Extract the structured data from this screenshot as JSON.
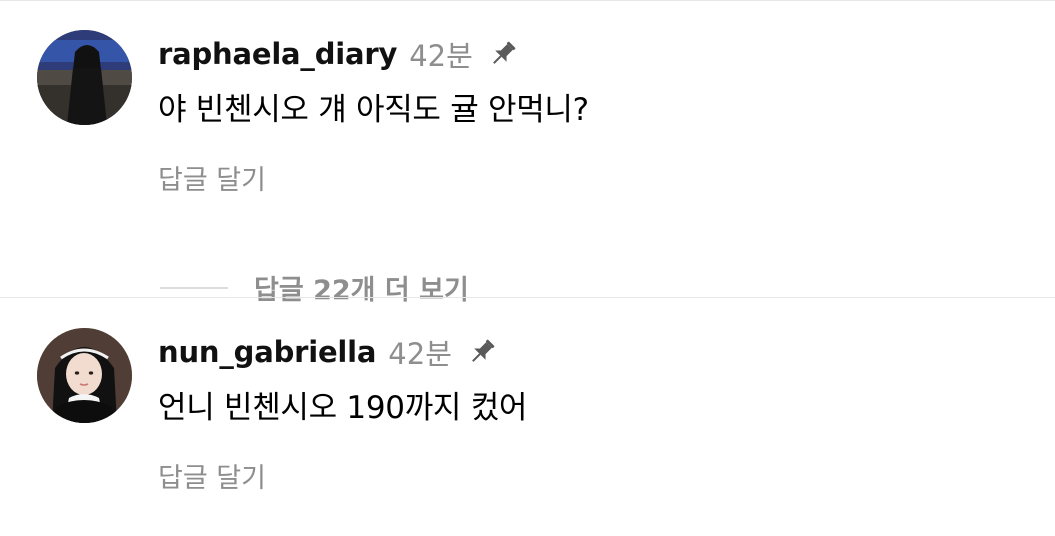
{
  "comments": [
    {
      "username": "raphaela_diary",
      "time": "42분",
      "text": "야 빈첸시오 걔 아직도 귤 안먹니?",
      "reply_label": "답글 달기",
      "avatar_icon": "nun-photo-avatar",
      "pin_icon": "pin-icon"
    },
    {
      "username": "nun_gabriella",
      "time": "42분",
      "text": "언니 빈첸시오 190까지 컸어",
      "reply_label": "답글 달기",
      "avatar_icon": "nun-portrait-avatar",
      "pin_icon": "pin-icon"
    }
  ],
  "view_replies": "답글 22개 더 보기",
  "colors": {
    "username": "#111111",
    "meta": "#8e8e8e",
    "divider": "#e6e6e6"
  }
}
